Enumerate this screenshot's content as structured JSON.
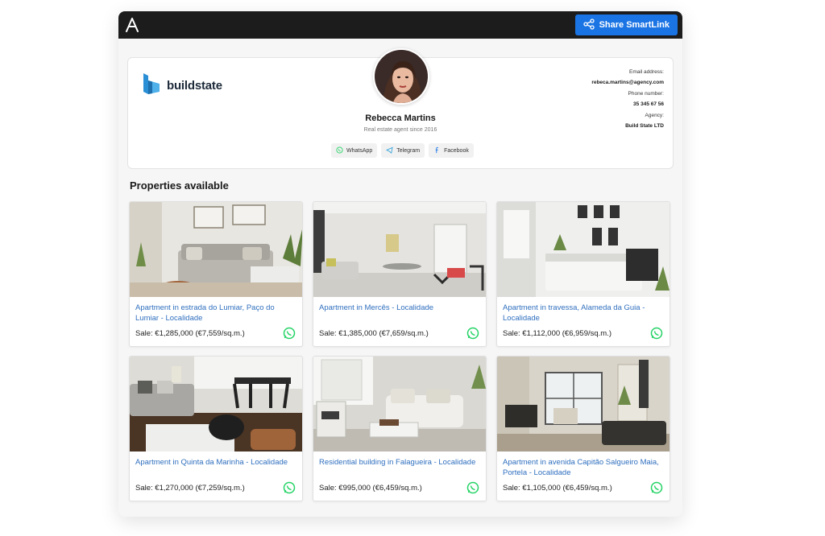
{
  "topbar": {
    "share_label": "Share SmartLink"
  },
  "brand": {
    "name": "buildstate"
  },
  "agent": {
    "name": "Rebecca Martins",
    "subtitle": "Real estate agent since 2016",
    "socials": [
      "WhatsApp",
      "Telegram",
      "Facebook"
    ]
  },
  "contact": {
    "email_label": "Email address:",
    "email": "rebeca.martins@agency.com",
    "phone_label": "Phone number:",
    "phone": "35 345 67 56",
    "agency_label": "Agency:",
    "agency": "Build State LTD"
  },
  "section_title": "Properties available",
  "properties": [
    {
      "title": "Apartment in estrada do Lumiar, Paço do Lumiar - Localidade",
      "price": "Sale: €1,285,000 (€7,559/sq.m.)"
    },
    {
      "title": "Apartment in Mercês - Localidade",
      "price": "Sale: €1,385,000 (€7,659/sq.m.)"
    },
    {
      "title": "Apartment in travessa, Alameda da Guia - Localidade",
      "price": "Sale: €1,112,000 (€6,959/sq.m.)"
    },
    {
      "title": "Apartment in Quinta da Marinha - Localidade",
      "price": "Sale: €1,270,000 (€7,259/sq.m.)"
    },
    {
      "title": "Residential building in Falagueira - Localidade",
      "price": "Sale: €995,000 (€6,459/sq.m.)"
    },
    {
      "title": "Apartment in avenida Capitão Salgueiro Maia, Portela - Localidade",
      "price": "Sale: €1,105,000 (€6,459/sq.m.)"
    }
  ],
  "colors": {
    "accent": "#1b74e4",
    "link": "#2f6fbf",
    "whatsapp": "#25d366",
    "topbar": "#1c1c1c"
  }
}
